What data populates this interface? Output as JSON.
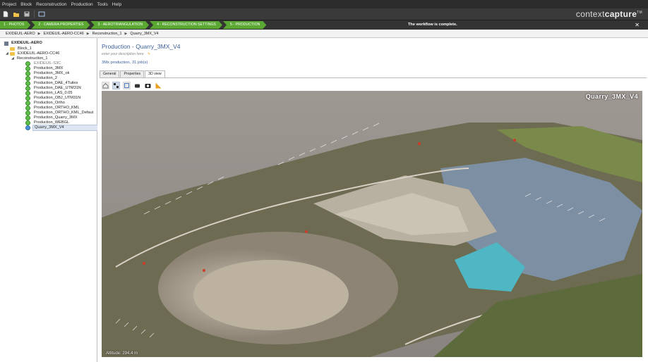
{
  "menu": [
    "Project",
    "Block",
    "Reconstruction",
    "Production",
    "Tools",
    "Help"
  ],
  "brand": {
    "light": "context",
    "bold": "capture",
    "mark": "TM"
  },
  "workflow": {
    "steps": [
      "1 - PHOTOS",
      "2 - CAMERA PROPERTIES",
      "3 - AEROTRIANGULATION",
      "4 - RECONSTRUCTION SETTINGS",
      "5 - PRODUCTION"
    ],
    "message": "The workflow is complete.",
    "close": "✕",
    "step_color": "#5aa832"
  },
  "breadcrumb": [
    "EXIDEUIL-AERO",
    "EXIDEUIL-AERO-CC46",
    "Reconstruction_1",
    "Quarry_3MX_V4"
  ],
  "tree": {
    "root": "EXIDEUIL-AERO",
    "block1": "Block_1",
    "block2": "EXIDEUIL-AERO-CC46",
    "reconstruction": "Reconstruction_1",
    "items": [
      "EXIDEUIL-S3C",
      "Production_3MX",
      "Production_3MX_ok",
      "Production_2",
      "Production_DAE_4Tuiles",
      "Production_DAE_UTM31N",
      "Production_LAS_0.05",
      "Production_OBJ_UTM31N",
      "Production_Ortho",
      "Production_ORTHO_KML",
      "Production_ORTHO_KML_Defaut",
      "Production_Quarry_3MX",
      "Production_WEBGL",
      "Quarry_3MX_V4"
    ]
  },
  "main": {
    "title": "Production - Quarry_3MX_V4",
    "description_placeholder": "enter your description here",
    "summary": "3Mx production, 31 job(s)",
    "tabs": [
      "General",
      "Properties",
      "3D view"
    ],
    "active_tab": "3D view",
    "viewer_label": "Quarry_3MX_V4",
    "viewer_status": "Altitude: 294.4 m"
  },
  "colors": {
    "accent": "#3b5e9a",
    "selected_bg": "#dde6f2"
  }
}
